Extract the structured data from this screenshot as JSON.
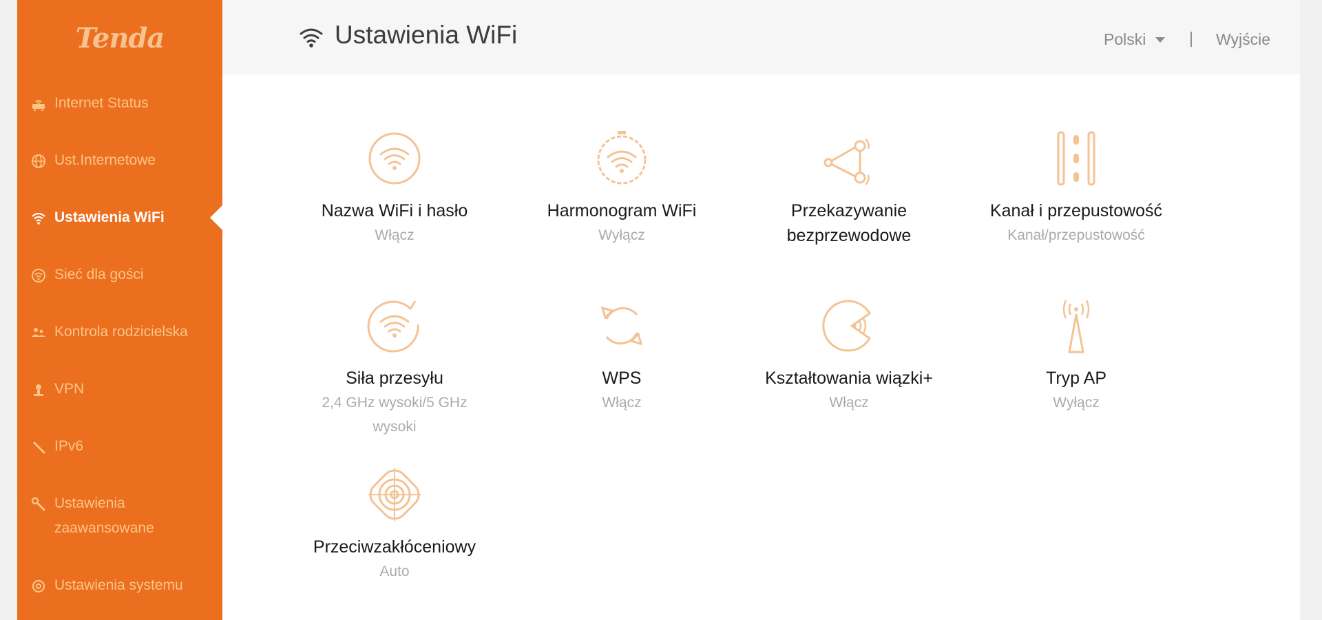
{
  "brand": {
    "logo_text": "Tenda"
  },
  "colors": {
    "accent": "#ec6e1f",
    "icon_stroke": "#f5c294",
    "sidebar_text": "#fbc685"
  },
  "sidebar": {
    "items": [
      {
        "label": "Internet Status",
        "icon": "router-icon"
      },
      {
        "label": "Ust.Internetowe",
        "icon": "globe-icon"
      },
      {
        "label": "Ustawienia WiFi",
        "icon": "wifi-icon",
        "active": true
      },
      {
        "label": "Sieć dla gości",
        "icon": "guest-network-icon"
      },
      {
        "label": "Kontrola rodzicielska",
        "icon": "parental-control-icon"
      },
      {
        "label": "VPN",
        "icon": "vpn-icon"
      },
      {
        "label": "IPv6",
        "icon": "ipv6-icon"
      },
      {
        "label": "Ustawienia\nzaawansowane",
        "icon": "wrench-icon"
      },
      {
        "label": "Ustawienia systemu",
        "icon": "settings-gear-icon"
      }
    ]
  },
  "header": {
    "title": "Ustawienia WiFi",
    "language": "Polski",
    "separator": "|",
    "logout": "Wyjście"
  },
  "tiles": [
    {
      "title": "Nazwa WiFi i hasło",
      "subtitle": "Włącz",
      "icon": "wifi-circle-icon"
    },
    {
      "title": "Harmonogram WiFi",
      "subtitle": "Wyłącz",
      "icon": "wifi-timer-icon"
    },
    {
      "title": "Przekazywanie\nbezprzewodowe",
      "subtitle": "",
      "icon": "wireless-repeat-icon"
    },
    {
      "title": "Kanał i przepustowość",
      "subtitle": "Kanał/przepustowość",
      "icon": "channel-bandwidth-icon"
    },
    {
      "title": "Siła przesyłu",
      "subtitle": "2,4 GHz wysoki/5 GHz\nwysoki",
      "icon": "transmit-power-icon"
    },
    {
      "title": "WPS",
      "subtitle": "Włącz",
      "icon": "wps-icon"
    },
    {
      "title": "Kształtowania wiązki+",
      "subtitle": "Włącz",
      "icon": "beamforming-icon"
    },
    {
      "title": "Tryp AP",
      "subtitle": "Wyłącz",
      "icon": "ap-mode-icon"
    },
    {
      "title": "Przeciwzakłóceniowy",
      "subtitle": "Auto",
      "icon": "anti-interference-icon"
    }
  ]
}
